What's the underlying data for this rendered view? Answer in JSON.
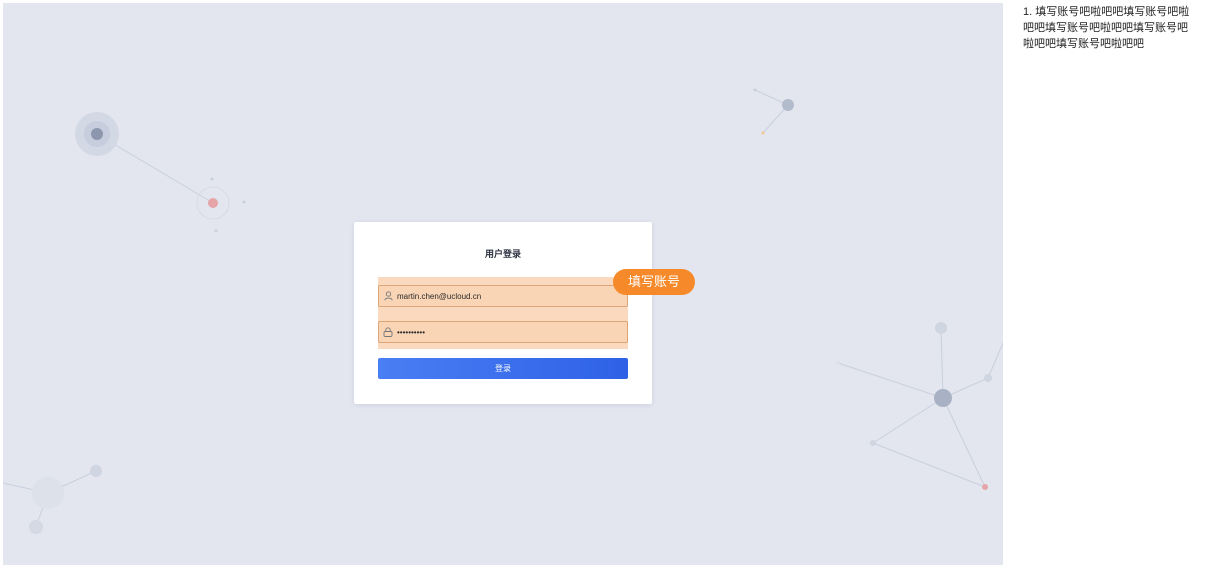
{
  "login": {
    "title": "用户登录",
    "account_value": "martin.chen@ucloud.cn",
    "password_value": "••••••••••",
    "submit_label": "登录"
  },
  "tooltip": {
    "text": "填写账号"
  },
  "side_note": {
    "text": "1. 填写账号吧啦吧吧填写账号吧啦吧吧填写账号吧啦吧吧填写账号吧啦吧吧填写账号吧啦吧吧"
  },
  "colors": {
    "stage_background": "#e4e6ef",
    "tooltip": "#f68a2a",
    "highlight": "#f7aa6e",
    "primary_button": "#2e61e6"
  },
  "icons": {
    "account": "user-icon",
    "password": "lock-icon"
  }
}
